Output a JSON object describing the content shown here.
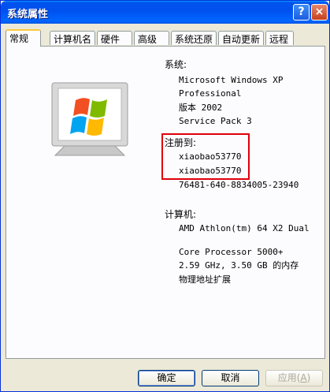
{
  "window": {
    "title": "系统属性",
    "help_glyph": "?",
    "close_glyph": "×"
  },
  "tabs": [
    "常规",
    "计算机名",
    "硬件",
    "高级",
    "系统还原",
    "自动更新",
    "远程"
  ],
  "system": {
    "header": "系统:",
    "lines": [
      "Microsoft Windows XP",
      "Professional",
      "版本 2002",
      "Service Pack 3"
    ]
  },
  "registered": {
    "header": "注册到:",
    "lines": [
      "xiaobao53770",
      "xiaobao53770"
    ],
    "product_id": "76481-640-8834005-23940"
  },
  "computer": {
    "header": "计算机:",
    "lines": [
      "AMD Athlon(tm) 64 X2 Dual",
      "",
      "Core Processor 5000+",
      "2.59 GHz, 3.50 GB 的内存",
      "物理地址扩展"
    ]
  },
  "buttons": {
    "ok": "确定",
    "cancel": "取消",
    "apply_prefix": "应用(",
    "apply_key": "A",
    "apply_suffix": ")"
  },
  "colors": {
    "highlight_border": "#e0000b",
    "title_bar": "#0054e3"
  }
}
